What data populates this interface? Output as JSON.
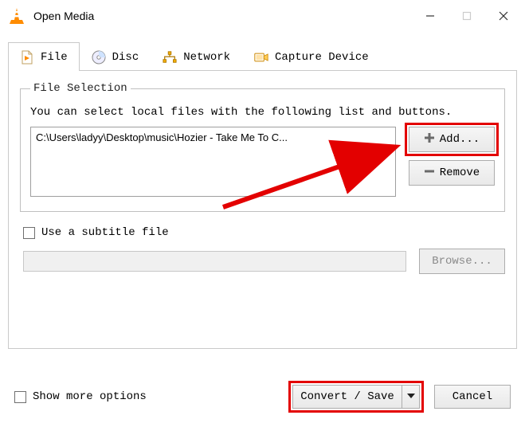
{
  "window": {
    "title": "Open Media"
  },
  "tabs": {
    "file": "File",
    "disc": "Disc",
    "network": "Network",
    "capture": "Capture Device"
  },
  "fileSelection": {
    "legend": "File Selection",
    "help": "You can select local files with the following list and buttons.",
    "items": [
      "C:\\Users\\ladyy\\Desktop\\music\\Hozier - Take Me To C..."
    ],
    "addLabel": "Add...",
    "removeLabel": "Remove"
  },
  "subtitle": {
    "checkboxLabel": "Use a subtitle file",
    "browseLabel": "Browse..."
  },
  "bottom": {
    "showMore": "Show more options",
    "convert": "Convert / Save",
    "cancel": "Cancel"
  },
  "icons": {
    "file": "file-icon",
    "disc": "disc-icon",
    "network": "network-icon",
    "capture": "capture-icon",
    "plus": "plus-icon",
    "minus": "minus-icon",
    "dropdown": "chevron-down-icon",
    "app": "vlc-cone-icon"
  }
}
